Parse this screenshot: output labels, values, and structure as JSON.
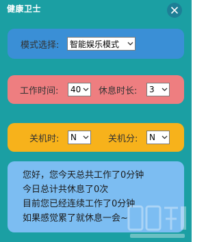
{
  "window": {
    "title": "健康卫士"
  },
  "mode": {
    "label": "模式选择:",
    "selected": "智能娱乐模式"
  },
  "work": {
    "work_label": "工作时间:",
    "work_value": "40",
    "rest_label": "休息时长:",
    "rest_value": "3"
  },
  "shutdown": {
    "hour_label": "关机时:",
    "hour_value": "N",
    "minute_label": "关机分:",
    "minute_value": "N"
  },
  "info": {
    "lines": [
      "您好，您今天总共工作了0分钟",
      "今日总计共休息了0次",
      "目前您已经连续工作了0分钟",
      "如果感觉累了就休息一会~"
    ]
  },
  "colors": {
    "window_bg": "#1b9fa3",
    "mode_card": "#3a8fd6",
    "work_card": "#ee7e80",
    "shutdown_card": "#f7b21b",
    "info_card": "#7cbdf2"
  },
  "icons": {
    "close": "close-icon",
    "dropdown": "chevron-down-icon",
    "watermark": "watermark-logo"
  }
}
